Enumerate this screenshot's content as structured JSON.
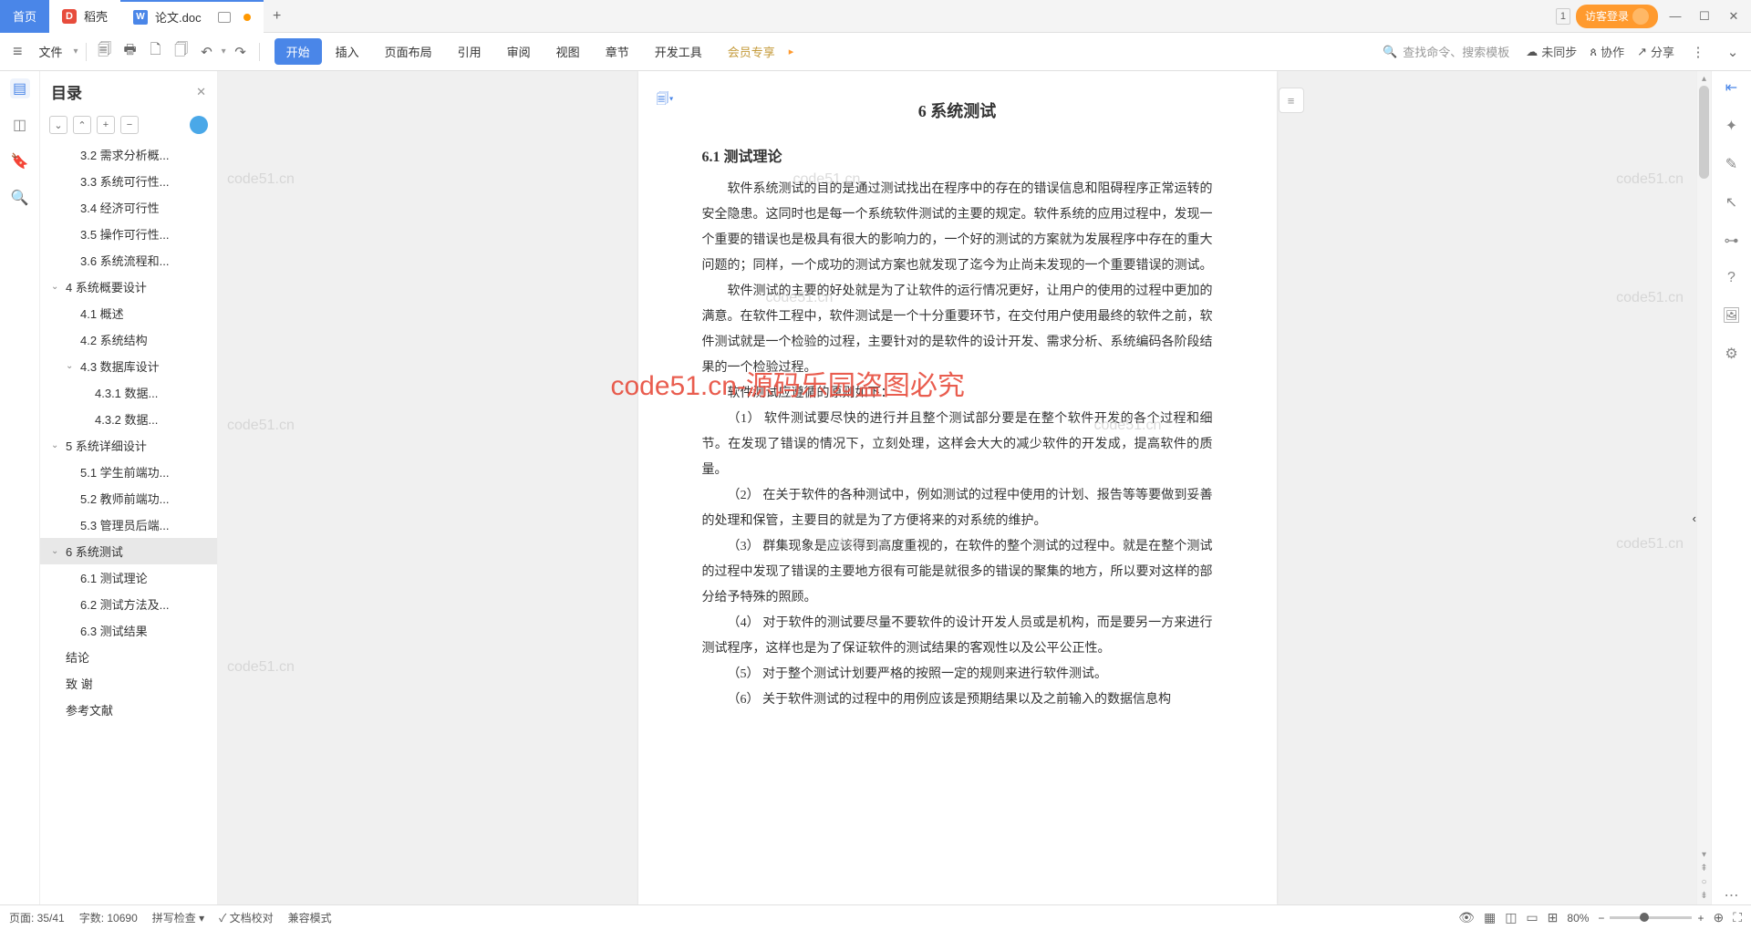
{
  "titlebar": {
    "home": "首页",
    "shell": "稻壳",
    "docname": "论文.doc",
    "guest": "访客登录",
    "badge": "1"
  },
  "ribbon": {
    "file": "文件",
    "tabs": [
      "开始",
      "插入",
      "页面布局",
      "引用",
      "审阅",
      "视图",
      "章节",
      "开发工具",
      "会员专享"
    ],
    "search_placeholder": "查找命令、搜索模板",
    "unsynced": "未同步",
    "collab": "协作",
    "share": "分享"
  },
  "outline": {
    "title": "目录",
    "items": [
      {
        "lvl": 3,
        "txt": "3.2 需求分析概..."
      },
      {
        "lvl": 3,
        "txt": "3.3 系统可行性..."
      },
      {
        "lvl": 3,
        "txt": "3.4 经济可行性"
      },
      {
        "lvl": 3,
        "txt": "3.5 操作可行性..."
      },
      {
        "lvl": 3,
        "txt": "3.6 系统流程和..."
      },
      {
        "lvl": 1,
        "txt": "4 系统概要设计",
        "exp": true
      },
      {
        "lvl": 3,
        "txt": "4.1 概述"
      },
      {
        "lvl": 3,
        "txt": "4.2 系统结构"
      },
      {
        "lvl": 2,
        "txt": "4.3 数据库设计",
        "exp": true
      },
      {
        "lvl": 4,
        "txt": "4.3.1 数据..."
      },
      {
        "lvl": 4,
        "txt": "4.3.2 数据..."
      },
      {
        "lvl": 1,
        "txt": "5 系统详细设计",
        "exp": true
      },
      {
        "lvl": 3,
        "txt": "5.1 学生前端功..."
      },
      {
        "lvl": 3,
        "txt": "5.2 教师前端功..."
      },
      {
        "lvl": 3,
        "txt": "5.3 管理员后端..."
      },
      {
        "lvl": 1,
        "txt": "6  系统测试",
        "exp": true,
        "sel": true
      },
      {
        "lvl": 3,
        "txt": "6.1 测试理论"
      },
      {
        "lvl": 3,
        "txt": "6.2 测试方法及..."
      },
      {
        "lvl": 3,
        "txt": "6.3 测试结果"
      },
      {
        "lvl": 2,
        "txt": "结论"
      },
      {
        "lvl": 2,
        "txt": "致   谢"
      },
      {
        "lvl": 2,
        "txt": "参考文献"
      }
    ]
  },
  "doc": {
    "h1": "6  系统测试",
    "h2": "6.1  测试理论",
    "p1": "软件系统测试的目的是通过测试找出在程序中的存在的错误信息和阻碍程序正常运转的安全隐患。这同时也是每一个系统软件测试的主要的规定。软件系统的应用过程中，发现一个重要的错误也是极具有很大的影响力的，一个好的测试的方案就为发展程序中存在的重大问题的；同样，一个成功的测试方案也就发现了迄今为止尚未发现的一个重要错误的测试。",
    "p2": "软件测试的主要的好处就是为了让软件的运行情况更好，让用户的使用的过程中更加的满意。在软件工程中，软件测试是一个十分重要环节，在交付用户使用最终的软件之前，软件测试就是一个检验的过程，主要针对的是软件的设计开发、需求分析、系统编码各阶段结果的一个检验过程。",
    "p3": "软件测试应遵循的原则如下：",
    "p4": "（1） 软件测试要尽快的进行并且整个测试部分要是在整个软件开发的各个过程和细节。在发现了错误的情况下，立刻处理，这样会大大的减少软件的开发成，提高软件的质量。",
    "p5": "（2） 在关于软件的各种测试中，例如测试的过程中使用的计划、报告等等要做到妥善的处理和保管，主要目的就是为了方便将来的对系统的维护。",
    "p6": "（3） 群集现象是应该得到高度重视的，在软件的整个测试的过程中。就是在整个测试的过程中发现了错误的主要地方很有可能是就很多的错误的聚集的地方，所以要对这样的部分给予特殊的照顾。",
    "p7": "（4） 对于软件的测试要尽量不要软件的设计开发人员或是机构，而是要另一方来进行测试程序，这样也是为了保证软件的测试结果的客观性以及公平公正性。",
    "p8": "（5） 对于整个测试计划要严格的按照一定的规则来进行软件测试。",
    "p9": "（6） 关于软件测试的过程中的用例应该是预期结果以及之前输入的数据信息构"
  },
  "watermarks": {
    "w1": "code51.cn",
    "red": "code51.cn-源码乐园盗图必究"
  },
  "status": {
    "page": "页面: 35/41",
    "words": "字数: 10690",
    "spell": "拼写检查",
    "proof": "文档校对",
    "compat": "兼容模式",
    "zoom": "80%"
  }
}
